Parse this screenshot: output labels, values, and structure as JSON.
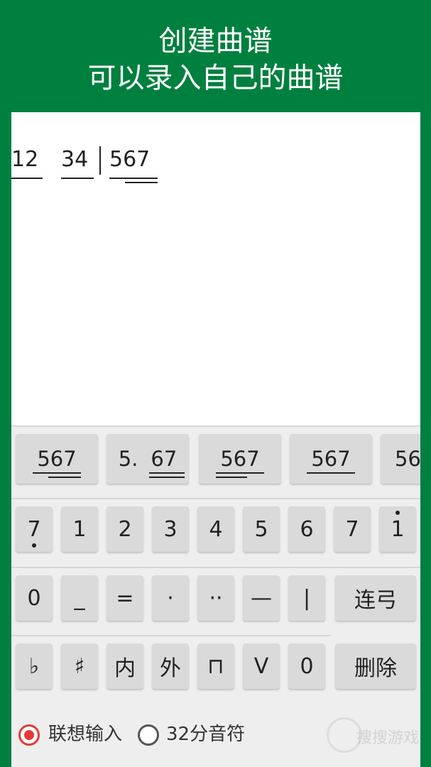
{
  "header": {
    "line1": "创建曲谱",
    "line2": "可以录入自己的曲谱"
  },
  "score": {
    "group1": "12",
    "group2": "34",
    "group3": "567"
  },
  "rhythm_keys": [
    "567",
    "5.",
    "67",
    "567",
    "567",
    "56"
  ],
  "note_keys": [
    "7",
    "1",
    "2",
    "3",
    "4",
    "5",
    "6",
    "7",
    "1"
  ],
  "symbol_keys": [
    "0",
    "_",
    "=",
    "·",
    "··",
    "—",
    "|"
  ],
  "accidental_keys": [
    "♭",
    "♯",
    "内",
    "外",
    "⊓",
    "V",
    "0"
  ],
  "side_keys": {
    "slur": "连弓",
    "delete": "删除"
  },
  "options": {
    "predictive": "联想输入",
    "thirtysecond": "32分音符"
  },
  "watermark": "搜搜游戏",
  "colors": {
    "header_green": "#00803f",
    "radio_red": "#e53935"
  }
}
